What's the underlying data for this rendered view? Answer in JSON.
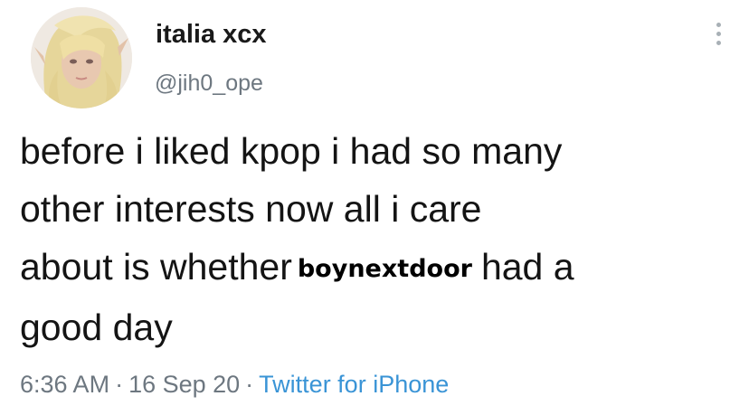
{
  "author": {
    "display_name": "italia xcx",
    "handle": "@jih0_ope",
    "avatar": "avatar-blonde-character"
  },
  "menu_icon": "more-options-vertical-dots-icon",
  "tweet": {
    "lines": [
      "before i liked kpop i had so many",
      "other interests now all i care",
      "about is whether",
      "had a",
      "good day"
    ],
    "overlay_word": "boynextdoor"
  },
  "meta": {
    "time": "6:36 AM",
    "date": "16 Sep 20",
    "source": "Twitter for iPhone",
    "separator": "·"
  },
  "colors": {
    "text": "#141414",
    "muted": "#6d7780",
    "link": "#3a94d6",
    "background": "#ffffff"
  }
}
